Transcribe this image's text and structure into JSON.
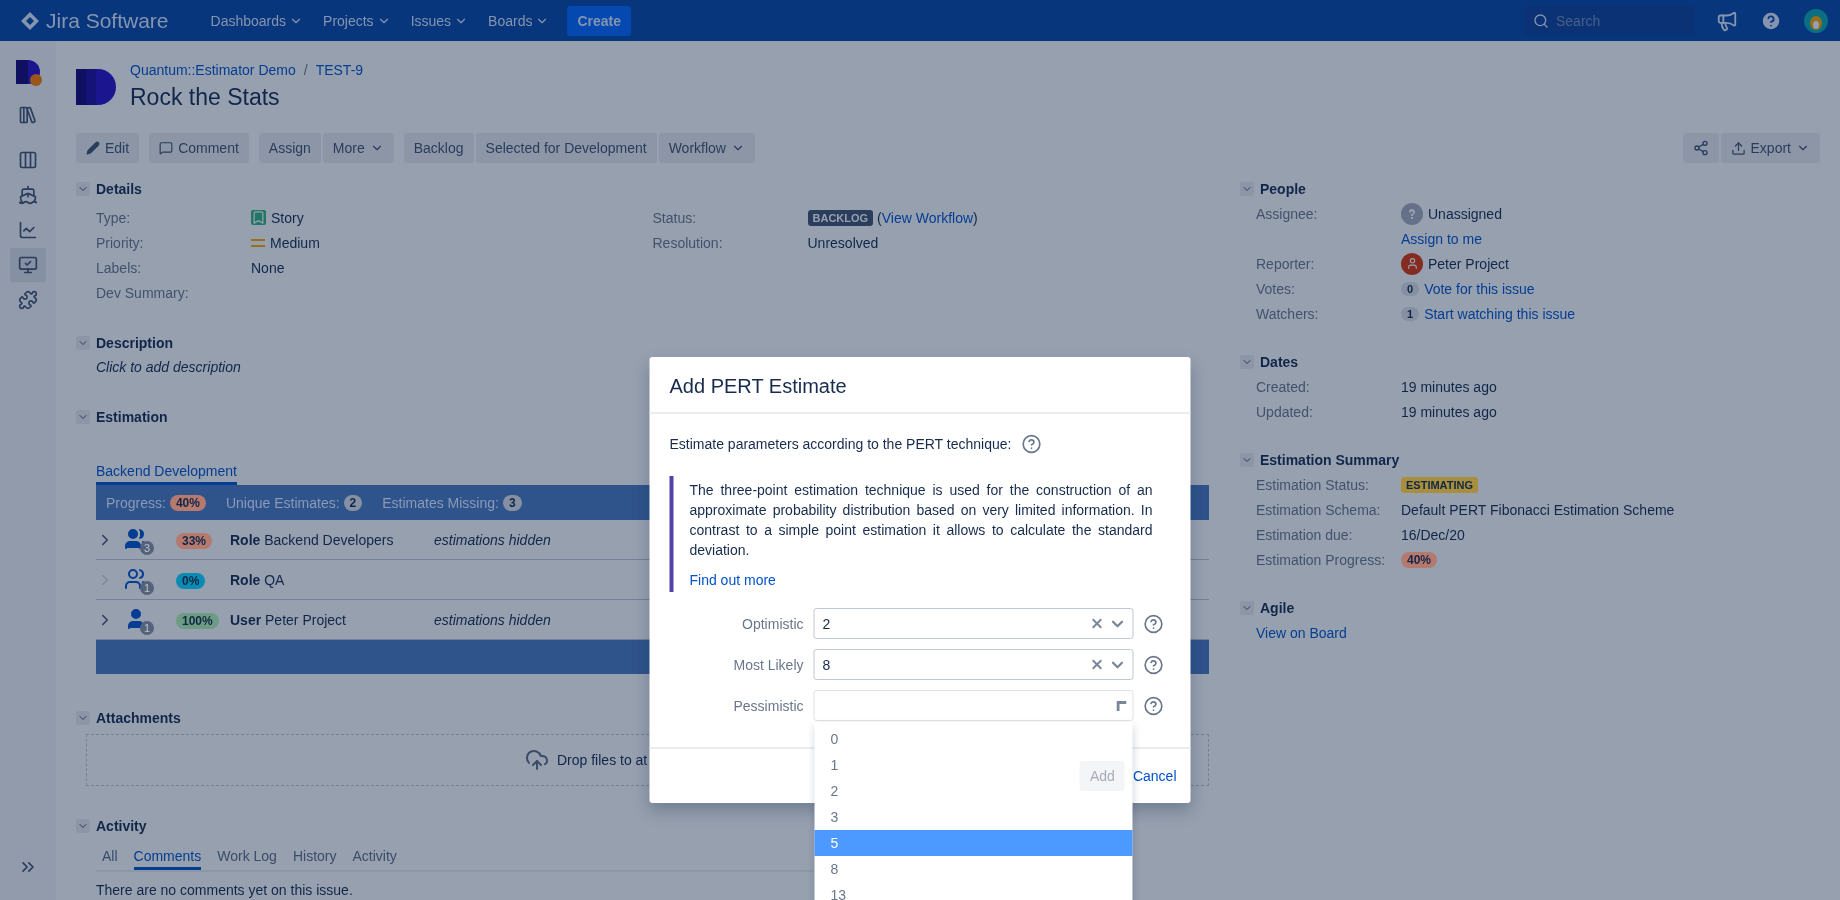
{
  "nav": {
    "product": "Jira Software",
    "menus": [
      {
        "label": "Dashboards"
      },
      {
        "label": "Projects"
      },
      {
        "label": "Issues"
      },
      {
        "label": "Boards"
      }
    ],
    "create": "Create",
    "search": {
      "placeholder": "Search"
    }
  },
  "sidebar": {
    "items": [
      {
        "kind": "project",
        "selected": false
      },
      {
        "kind": "backlog",
        "selected": false
      },
      {
        "kind": "board",
        "selected": false
      },
      {
        "kind": "releases",
        "selected": false
      },
      {
        "kind": "reports",
        "selected": false
      },
      {
        "kind": "estimator",
        "selected": true
      },
      {
        "kind": "addons",
        "selected": false
      }
    ]
  },
  "breadcrumbs": [
    "Quantum::Estimator Demo",
    "TEST-9"
  ],
  "breadcrumb_separator": "/",
  "title": "Rock the Stats",
  "toolbar": {
    "groups": [
      [
        {
          "label": "Edit",
          "kind": "pencil"
        }
      ],
      [
        {
          "label": "Comment",
          "kind": "comment"
        }
      ],
      [
        {
          "label": "Assign",
          "kind": "plain"
        },
        {
          "label": "More",
          "kind": "dropdown"
        }
      ],
      [
        {
          "label": "Backlog",
          "kind": "plain"
        },
        {
          "label": "Selected for Development",
          "kind": "plain"
        },
        {
          "label": "Workflow",
          "kind": "dropdown"
        }
      ]
    ],
    "right": [
      {
        "kind": "share"
      },
      {
        "label": "Export",
        "kind": "export"
      }
    ]
  },
  "details": {
    "title": "Details",
    "left": [
      {
        "label": "Type:",
        "kind": "type",
        "value": "Story"
      },
      {
        "label": "Priority:",
        "kind": "priority",
        "value": "Medium"
      },
      {
        "label": "Labels:",
        "kind": "text",
        "value": "None"
      },
      {
        "label": "Dev Summary:",
        "kind": "text"
      }
    ],
    "right": [
      {
        "label": "Status:",
        "kind": "status",
        "badge": "BACKLOG",
        "link_prefix": "(",
        "link": "View Workflow",
        "link_suffix": ")"
      },
      {
        "label": "Resolution:",
        "kind": "text",
        "value": "Unresolved"
      }
    ]
  },
  "description": {
    "title": "Description",
    "text": "Click to add description"
  },
  "estimation": {
    "title": "Estimation",
    "tabs": [
      {
        "label": "Backend Development",
        "selected": true
      }
    ],
    "summary": [
      {
        "label": "Progress:",
        "value": "40%",
        "color": "#b5796e"
      },
      {
        "label": "Unique Estimates:",
        "value": "2",
        "color": "#8590a2"
      },
      {
        "label": "Estimates Missing:",
        "value": "3",
        "color": "#8590a2"
      }
    ],
    "rows": [
      {
        "kind": "role",
        "expandable": true,
        "count": "3",
        "percent": "33%",
        "color": "#b5796e",
        "type": "Role",
        "name": "Backend Developers",
        "note": "estimations hidden"
      },
      {
        "kind": "role",
        "expandable": false,
        "count": "1",
        "percent": "0%",
        "color": "#0a8bb3",
        "type": "Role",
        "name": "QA"
      },
      {
        "kind": "user",
        "expandable": true,
        "count": "1",
        "percent": "100%",
        "color": "#6e9c82",
        "type": "User",
        "name": "Peter Project",
        "note": "estimations hidden"
      }
    ]
  },
  "attachments": {
    "title": "Attachments",
    "drop_text": "Drop files to at"
  },
  "activity": {
    "title": "Activity",
    "tabs": [
      {
        "label": "All",
        "selected": false
      },
      {
        "label": "Comments",
        "selected": true
      },
      {
        "label": "Work Log",
        "selected": false
      },
      {
        "label": "History",
        "selected": false
      },
      {
        "label": "Activity",
        "selected": false
      }
    ],
    "empty": "There are no comments yet on this issue."
  },
  "side_sections": [
    {
      "title": "People",
      "rows": [
        {
          "label": "Assignee:",
          "kind": "unassigned",
          "value": "Unassigned",
          "link": "Assign to me"
        },
        {
          "label": "Reporter:",
          "kind": "person",
          "value": "Peter Project"
        },
        {
          "label": "Votes:",
          "kind": "count",
          "count": "0",
          "link": "Vote for this issue"
        },
        {
          "label": "Watchers:",
          "kind": "count",
          "count": "1",
          "link": "Start watching this issue"
        }
      ]
    },
    {
      "title": "Dates",
      "rows": [
        {
          "label": "Created:",
          "kind": "text",
          "value": "19 minutes ago"
        },
        {
          "label": "Updated:",
          "kind": "text",
          "value": "19 minutes ago"
        }
      ]
    },
    {
      "title": "Estimation Summary",
      "rows": [
        {
          "label": "Estimation Status:",
          "kind": "lozenge",
          "value": "ESTIMATING"
        },
        {
          "label": "Estimation Schema:",
          "kind": "text",
          "value": "Default PERT Fibonacci Estimation Scheme"
        },
        {
          "label": "Estimation due:",
          "kind": "text",
          "value": "16/Dec/20"
        },
        {
          "label": "Estimation Progress:",
          "kind": "percent",
          "value": "40%",
          "color": "#b5796e"
        }
      ]
    },
    {
      "title": "Agile",
      "rows": [
        {
          "kind": "link",
          "link": "View on Board"
        }
      ]
    }
  ],
  "modal": {
    "title": "Add PERT Estimate",
    "intro": "Estimate parameters according to the PERT technique:",
    "info": "The three-point estimation technique is used for the construction of an approximate probability distribution based on very limited information. In contrast to a simple point estimation it allows to calculate the standard deviation.",
    "info_link": "Find out more",
    "fields": [
      {
        "label": "Optimistic",
        "value": "2",
        "open": false
      },
      {
        "label": "Most Likely",
        "value": "8",
        "open": false
      },
      {
        "label": "Pessimistic",
        "open": true,
        "options": [
          {
            "label": "0",
            "selected": false
          },
          {
            "label": "1",
            "selected": false
          },
          {
            "label": "2",
            "selected": false
          },
          {
            "label": "3",
            "selected": false
          },
          {
            "label": "5",
            "selected": true
          },
          {
            "label": "8",
            "selected": false
          },
          {
            "label": "13",
            "selected": false
          }
        ]
      }
    ],
    "add": {
      "label": "Add",
      "disabled": true
    },
    "cancel": "Cancel"
  }
}
